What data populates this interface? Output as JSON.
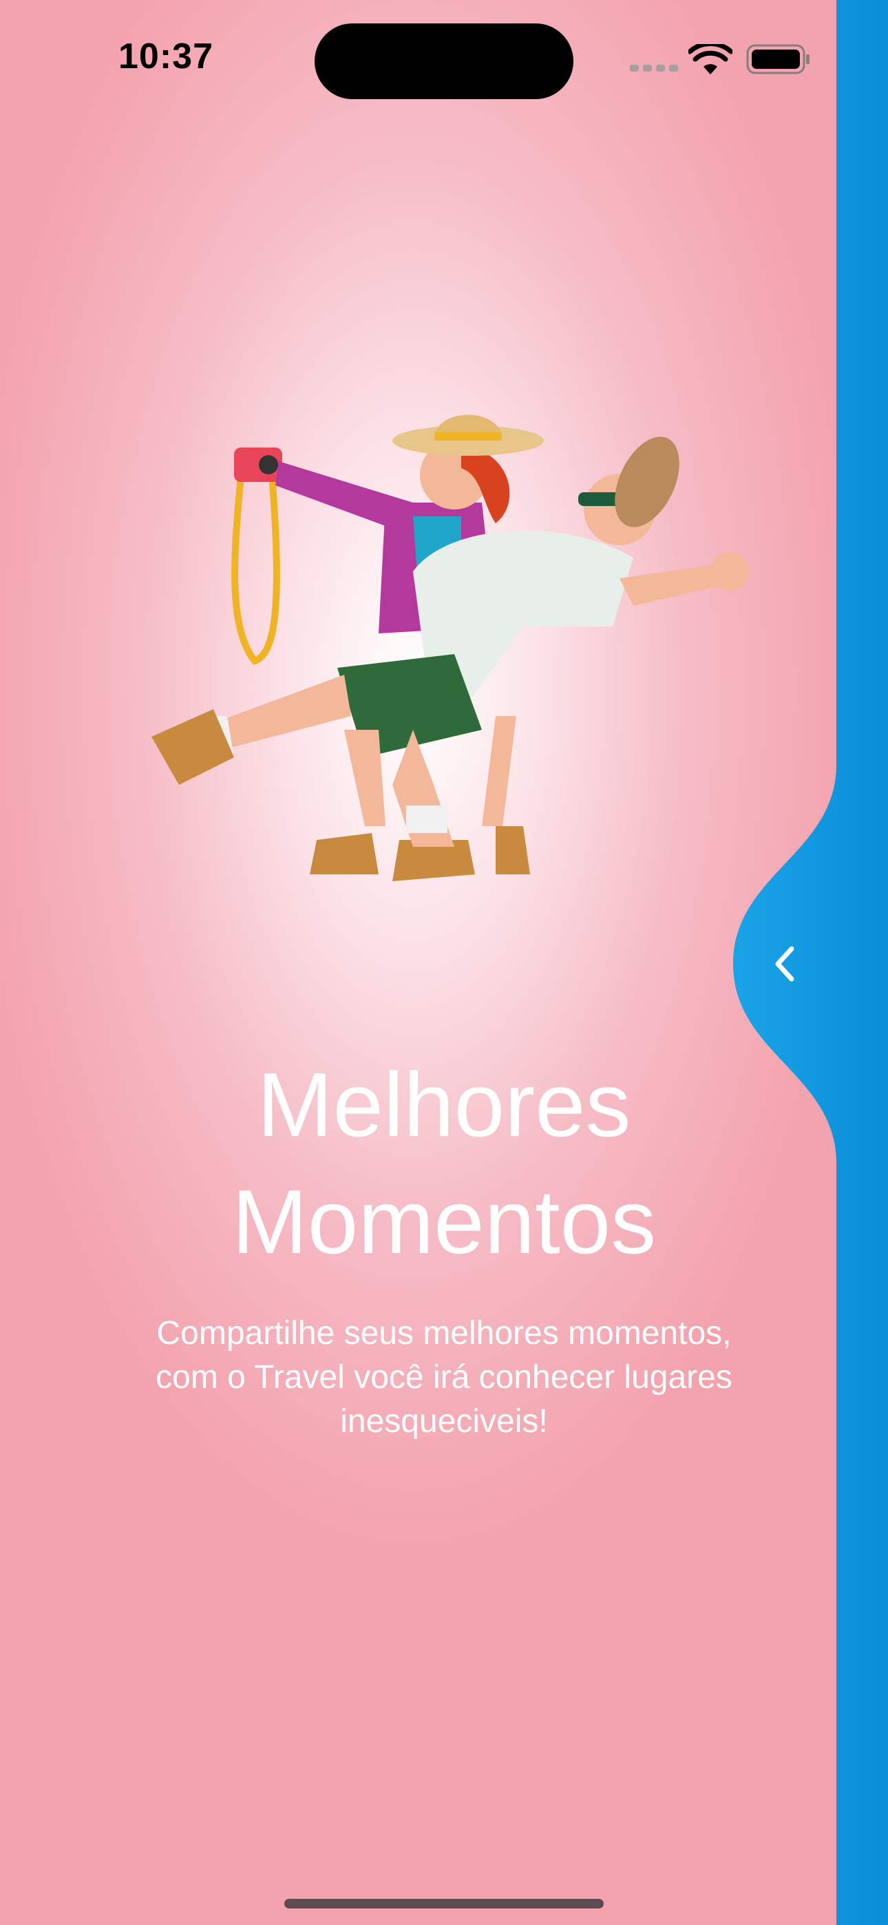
{
  "status_bar": {
    "time": "10:37",
    "icons": [
      "cellular-signal-icon",
      "wifi-icon",
      "battery-icon"
    ]
  },
  "onboarding": {
    "title": "Melhores Momentos",
    "subtitle": "Compartilhe seus melhores momentos, com o Travel você irá conhecer lugares inesqueciveis!",
    "illustration": "couple-selfie-illustration",
    "back_icon": "chevron-left-icon"
  },
  "colors": {
    "background_center": "#ffffff",
    "background_edge": "#f3a3ae",
    "panel_blue": "#0a8ed6",
    "text": "#ffffff"
  }
}
